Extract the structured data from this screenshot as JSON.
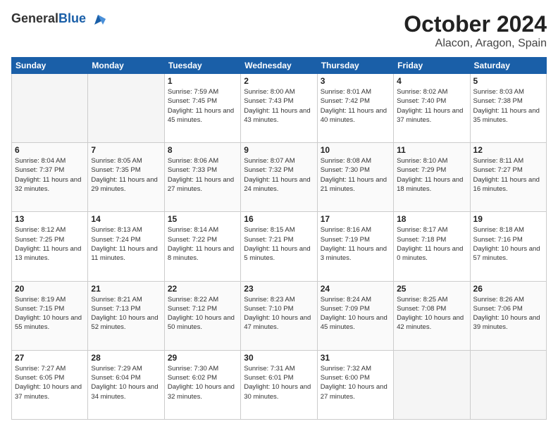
{
  "logo": {
    "general": "General",
    "blue": "Blue"
  },
  "header": {
    "month": "October 2024",
    "location": "Alacon, Aragon, Spain"
  },
  "weekdays": [
    "Sunday",
    "Monday",
    "Tuesday",
    "Wednesday",
    "Thursday",
    "Friday",
    "Saturday"
  ],
  "weeks": [
    [
      {
        "day": "",
        "info": ""
      },
      {
        "day": "",
        "info": ""
      },
      {
        "day": "1",
        "info": "Sunrise: 7:59 AM\nSunset: 7:45 PM\nDaylight: 11 hours and 45 minutes."
      },
      {
        "day": "2",
        "info": "Sunrise: 8:00 AM\nSunset: 7:43 PM\nDaylight: 11 hours and 43 minutes."
      },
      {
        "day": "3",
        "info": "Sunrise: 8:01 AM\nSunset: 7:42 PM\nDaylight: 11 hours and 40 minutes."
      },
      {
        "day": "4",
        "info": "Sunrise: 8:02 AM\nSunset: 7:40 PM\nDaylight: 11 hours and 37 minutes."
      },
      {
        "day": "5",
        "info": "Sunrise: 8:03 AM\nSunset: 7:38 PM\nDaylight: 11 hours and 35 minutes."
      }
    ],
    [
      {
        "day": "6",
        "info": "Sunrise: 8:04 AM\nSunset: 7:37 PM\nDaylight: 11 hours and 32 minutes."
      },
      {
        "day": "7",
        "info": "Sunrise: 8:05 AM\nSunset: 7:35 PM\nDaylight: 11 hours and 29 minutes."
      },
      {
        "day": "8",
        "info": "Sunrise: 8:06 AM\nSunset: 7:33 PM\nDaylight: 11 hours and 27 minutes."
      },
      {
        "day": "9",
        "info": "Sunrise: 8:07 AM\nSunset: 7:32 PM\nDaylight: 11 hours and 24 minutes."
      },
      {
        "day": "10",
        "info": "Sunrise: 8:08 AM\nSunset: 7:30 PM\nDaylight: 11 hours and 21 minutes."
      },
      {
        "day": "11",
        "info": "Sunrise: 8:10 AM\nSunset: 7:29 PM\nDaylight: 11 hours and 18 minutes."
      },
      {
        "day": "12",
        "info": "Sunrise: 8:11 AM\nSunset: 7:27 PM\nDaylight: 11 hours and 16 minutes."
      }
    ],
    [
      {
        "day": "13",
        "info": "Sunrise: 8:12 AM\nSunset: 7:25 PM\nDaylight: 11 hours and 13 minutes."
      },
      {
        "day": "14",
        "info": "Sunrise: 8:13 AM\nSunset: 7:24 PM\nDaylight: 11 hours and 11 minutes."
      },
      {
        "day": "15",
        "info": "Sunrise: 8:14 AM\nSunset: 7:22 PM\nDaylight: 11 hours and 8 minutes."
      },
      {
        "day": "16",
        "info": "Sunrise: 8:15 AM\nSunset: 7:21 PM\nDaylight: 11 hours and 5 minutes."
      },
      {
        "day": "17",
        "info": "Sunrise: 8:16 AM\nSunset: 7:19 PM\nDaylight: 11 hours and 3 minutes."
      },
      {
        "day": "18",
        "info": "Sunrise: 8:17 AM\nSunset: 7:18 PM\nDaylight: 11 hours and 0 minutes."
      },
      {
        "day": "19",
        "info": "Sunrise: 8:18 AM\nSunset: 7:16 PM\nDaylight: 10 hours and 57 minutes."
      }
    ],
    [
      {
        "day": "20",
        "info": "Sunrise: 8:19 AM\nSunset: 7:15 PM\nDaylight: 10 hours and 55 minutes."
      },
      {
        "day": "21",
        "info": "Sunrise: 8:21 AM\nSunset: 7:13 PM\nDaylight: 10 hours and 52 minutes."
      },
      {
        "day": "22",
        "info": "Sunrise: 8:22 AM\nSunset: 7:12 PM\nDaylight: 10 hours and 50 minutes."
      },
      {
        "day": "23",
        "info": "Sunrise: 8:23 AM\nSunset: 7:10 PM\nDaylight: 10 hours and 47 minutes."
      },
      {
        "day": "24",
        "info": "Sunrise: 8:24 AM\nSunset: 7:09 PM\nDaylight: 10 hours and 45 minutes."
      },
      {
        "day": "25",
        "info": "Sunrise: 8:25 AM\nSunset: 7:08 PM\nDaylight: 10 hours and 42 minutes."
      },
      {
        "day": "26",
        "info": "Sunrise: 8:26 AM\nSunset: 7:06 PM\nDaylight: 10 hours and 39 minutes."
      }
    ],
    [
      {
        "day": "27",
        "info": "Sunrise: 7:27 AM\nSunset: 6:05 PM\nDaylight: 10 hours and 37 minutes."
      },
      {
        "day": "28",
        "info": "Sunrise: 7:29 AM\nSunset: 6:04 PM\nDaylight: 10 hours and 34 minutes."
      },
      {
        "day": "29",
        "info": "Sunrise: 7:30 AM\nSunset: 6:02 PM\nDaylight: 10 hours and 32 minutes."
      },
      {
        "day": "30",
        "info": "Sunrise: 7:31 AM\nSunset: 6:01 PM\nDaylight: 10 hours and 30 minutes."
      },
      {
        "day": "31",
        "info": "Sunrise: 7:32 AM\nSunset: 6:00 PM\nDaylight: 10 hours and 27 minutes."
      },
      {
        "day": "",
        "info": ""
      },
      {
        "day": "",
        "info": ""
      }
    ]
  ]
}
